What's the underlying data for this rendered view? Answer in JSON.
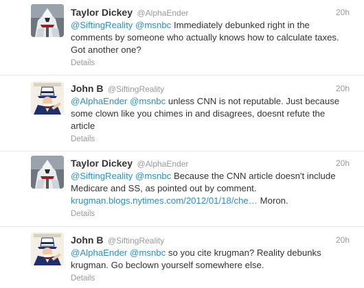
{
  "tweets": [
    {
      "name": "Taylor Dickey",
      "handle": "@AlphaEnder",
      "time": "20h",
      "avatar": "assassin-avatar",
      "mention1": "@SiftingReality",
      "mention2": "@msnbc",
      "body": "Immediately debunked right in the comments by someone who actually knows how to calculate taxes. Got another one?",
      "details": "Details"
    },
    {
      "name": "John B",
      "handle": "@SiftingReality",
      "time": "20h",
      "avatar": "uncle-sam-avatar",
      "mention1": "@AlphaEnder",
      "mention2": "@msnbc",
      "body": "unless CNN is not reputable. Just because some clown like you chimes in and disagrees, doesnt refute the article",
      "details": "Details"
    },
    {
      "name": "Taylor Dickey",
      "handle": "@AlphaEnder",
      "time": "20h",
      "avatar": "assassin-avatar",
      "mention1": "@SiftingReality",
      "mention2": "@msnbc",
      "body": "Because the CNN article doesn't include Medicare and SS, as pointed out by comment.",
      "link": "krugman.blogs.nytimes.com/2012/01/18/che…",
      "body_after": "Moron.",
      "details": "Details"
    },
    {
      "name": "John B",
      "handle": "@SiftingReality",
      "time": "20h",
      "avatar": "uncle-sam-avatar",
      "mention1": "@AlphaEnder",
      "mention2": "@msnbc",
      "body": "so you cite krugman? Reality debunks krugman. Go beclown yourself somewhere else.",
      "details": "Details"
    }
  ],
  "colors": {
    "link": "#2a8fc9",
    "muted": "#999999",
    "text": "#333333",
    "divider": "#e8e8e8"
  }
}
